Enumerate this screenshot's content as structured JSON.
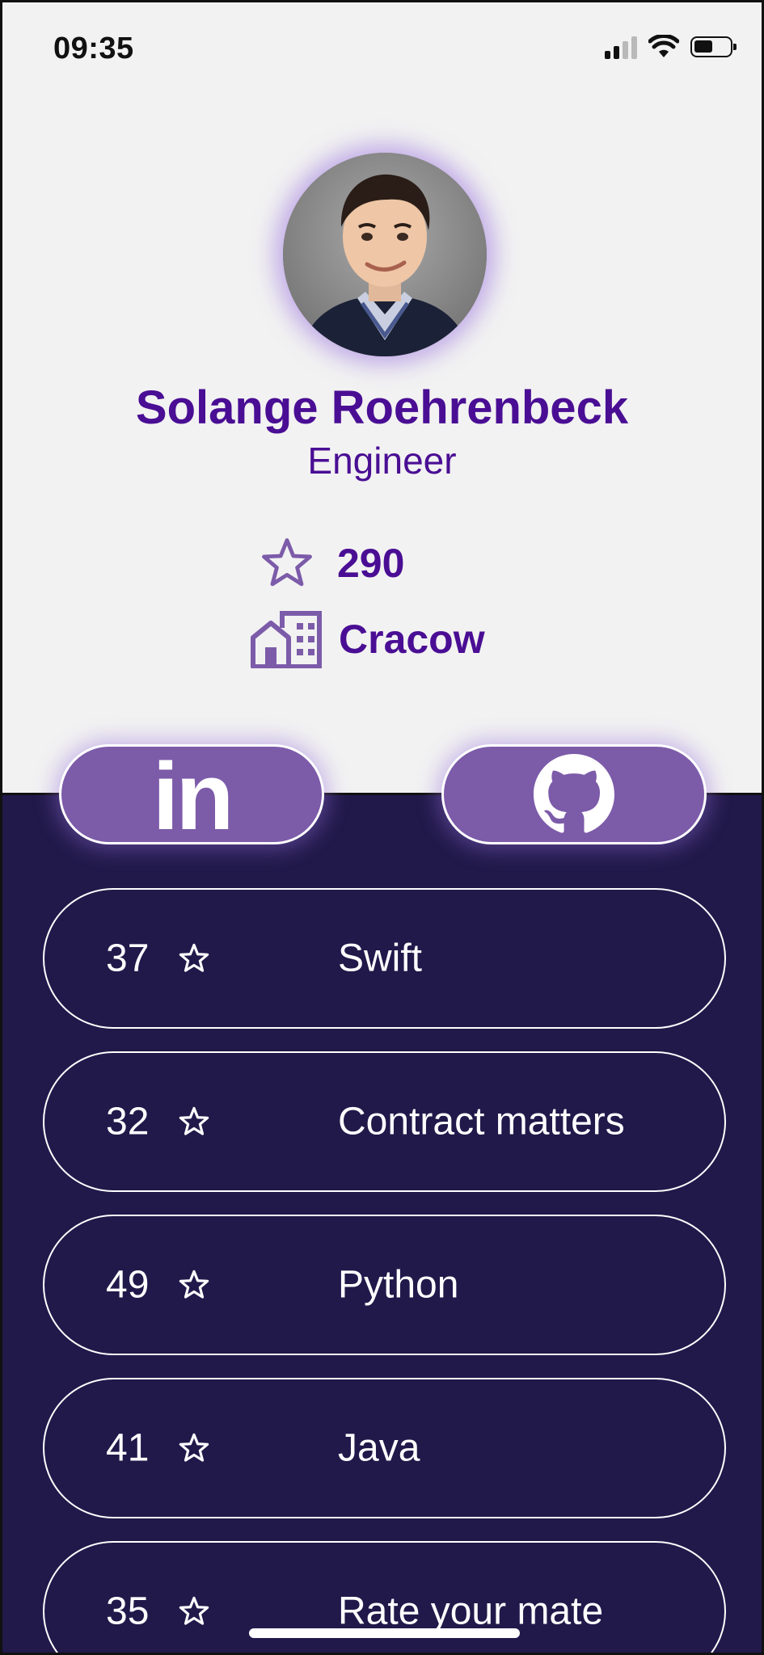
{
  "status_bar": {
    "time": "09:35",
    "signal_icon": "cellular-signal-icon",
    "wifi_icon": "wifi-icon",
    "battery_icon": "battery-icon"
  },
  "profile": {
    "name": "Solange Roehrenbeck",
    "role": "Engineer",
    "stars": "290",
    "city": "Cracow",
    "accent_color": "#4a0e94"
  },
  "social": {
    "linkedin_label": "in",
    "linkedin_icon": "linkedin-icon",
    "github_icon": "github-icon",
    "button_color": "#7c5ba9"
  },
  "skills": [
    {
      "count": "37",
      "label": "Swift"
    },
    {
      "count": "32",
      "label": "Contract matters"
    },
    {
      "count": "49",
      "label": "Python"
    },
    {
      "count": "41",
      "label": "Java"
    },
    {
      "count": "35",
      "label": "Rate your mate"
    }
  ],
  "theme": {
    "top_background": "#f2f2f2",
    "bottom_background": "#21194a"
  }
}
